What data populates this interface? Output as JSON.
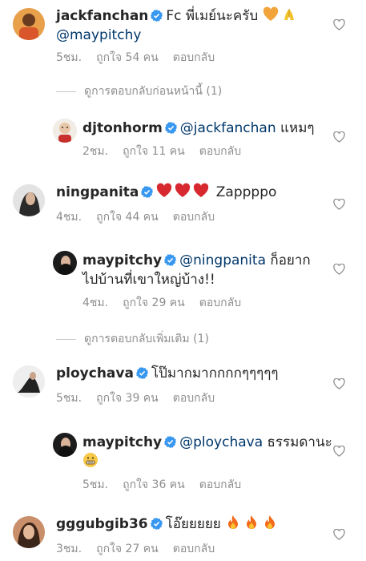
{
  "colors": {
    "text": "#262626",
    "meta": "#8e8e8e",
    "mention": "#00376b",
    "verified": "#3897f0",
    "heart_outline": "#8e8e8e"
  },
  "icons": {
    "verified": "verified-badge-icon",
    "like": "heart-outline-icon"
  },
  "comments": [
    {
      "username": "jackfanchan",
      "body": "Fc พี่เมย์นะครับ",
      "emojis": [
        "orange-heart-emoji",
        "folded-hands-emoji"
      ],
      "mention": "@maypitchy",
      "time": "5ชม.",
      "likes": "ถูกใจ 54 คน",
      "reply": "ตอบกลับ"
    },
    {
      "view_previous": "ดูการตอบกลับก่อนหน้านี้ (1)"
    },
    {
      "username": "djtonhorm",
      "mention": "@jackfanchan",
      "body": "แหมๆ",
      "time": "2ชม.",
      "likes": "ถูกใจ 11 คน",
      "reply": "ตอบกลับ"
    },
    {
      "username": "ningpanita",
      "emojis": [
        "red-heart-emoji",
        "red-heart-emoji",
        "red-heart-emoji"
      ],
      "body": "Zappppo",
      "time": "4ชม.",
      "likes": "ถูกใจ 44 คน",
      "reply": "ตอบกลับ"
    },
    {
      "username": "maypitchy",
      "mention": "@ningpanita",
      "body": "ก็อยาก",
      "body_line2": "ไปบ้านที่เขาใหญ่บ้าง!!",
      "time": "4ชม.",
      "likes": "ถูกใจ 29 คน",
      "reply": "ตอบกลับ"
    },
    {
      "view_more": "ดูการตอบกลับเพิ่มเติม (1)"
    },
    {
      "username": "ploychava",
      "body": "โป๊มากมากกกกๆๆๆๆๆ",
      "time": "5ชม.",
      "likes": "ถูกใจ 39 คน",
      "reply": "ตอบกลับ"
    },
    {
      "username": "maypitchy",
      "mention": "@ploychava",
      "body": "ธรรมดานะ",
      "emojis": [
        "grimacing-face-emoji"
      ],
      "time": "5ชม.",
      "likes": "ถูกใจ 36 คน",
      "reply": "ตอบกลับ"
    },
    {
      "username": "gggubgib36",
      "body": "โอ๊ยยยยย",
      "emojis": [
        "fire-emoji",
        "fire-emoji",
        "fire-emoji"
      ],
      "time": "3ชม.",
      "likes": "ถูกใจ 27 คน",
      "reply": "ตอบกลับ"
    }
  ]
}
